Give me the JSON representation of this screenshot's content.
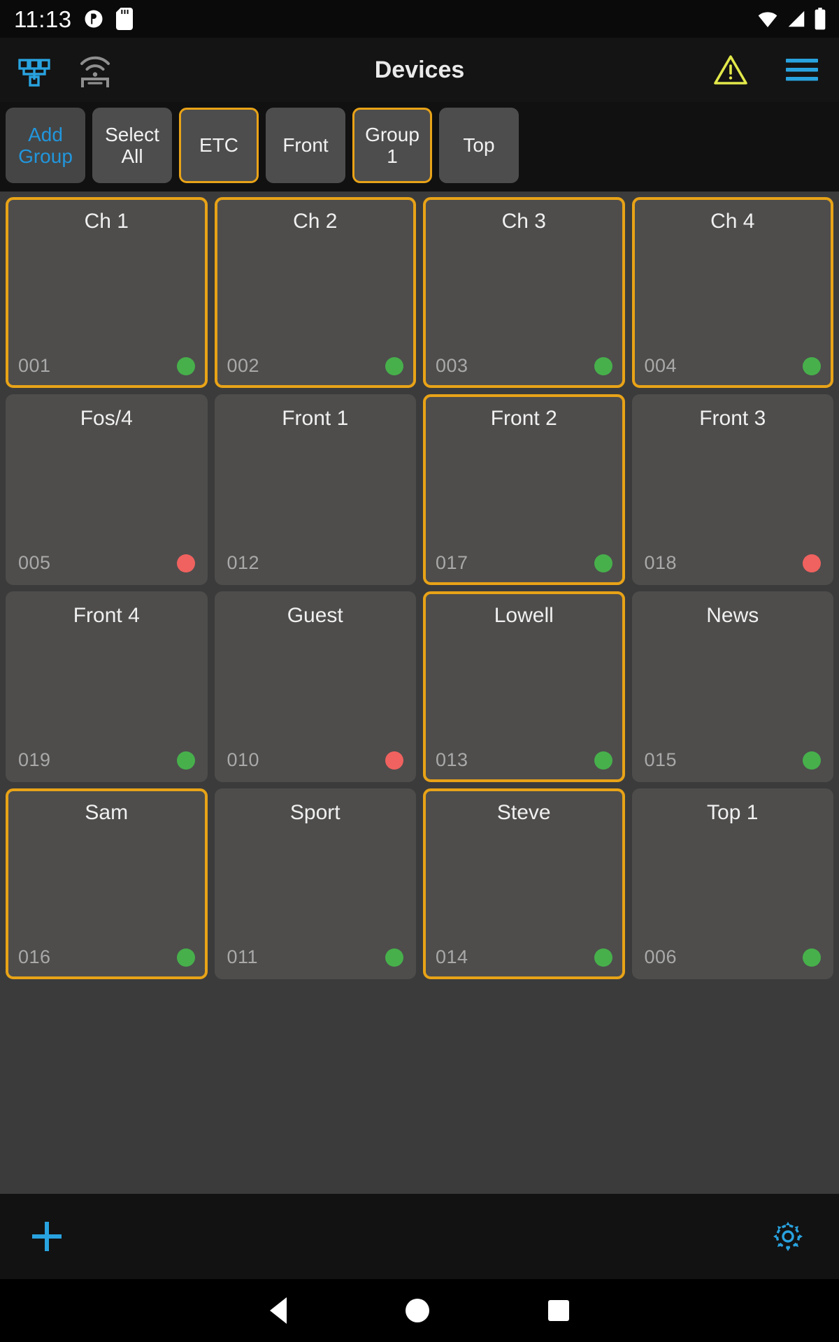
{
  "status_bar": {
    "clock": "11:13",
    "left_icons": [
      "do-not-disturb-icon",
      "sd-card-icon"
    ],
    "right_icons": [
      "wifi-icon",
      "cellular-signal-icon",
      "battery-icon"
    ]
  },
  "app_bar": {
    "title": "Devices",
    "left_icons": [
      "network-topology-icon",
      "wireless-access-point-icon"
    ],
    "right_icons": [
      "warning-icon",
      "menu-icon"
    ],
    "accent_blue": "#2196dd",
    "warning_color": "#e2e84a"
  },
  "group_bar": {
    "buttons": [
      {
        "label": "Add Group",
        "selected": false,
        "style": "add"
      },
      {
        "label": "Select All",
        "selected": false,
        "style": "normal"
      },
      {
        "label": "ETC",
        "selected": true,
        "style": "normal"
      },
      {
        "label": "Front",
        "selected": false,
        "style": "normal"
      },
      {
        "label": "Group 1",
        "selected": true,
        "style": "normal"
      },
      {
        "label": "Top",
        "selected": false,
        "style": "normal"
      }
    ],
    "selected_border_color": "#e8a317"
  },
  "devices": [
    {
      "name": "Ch 1",
      "id": "001",
      "status": "green",
      "selected": true
    },
    {
      "name": "Ch 2",
      "id": "002",
      "status": "green",
      "selected": true
    },
    {
      "name": "Ch 3",
      "id": "003",
      "status": "green",
      "selected": true
    },
    {
      "name": "Ch 4",
      "id": "004",
      "status": "green",
      "selected": true
    },
    {
      "name": "Fos/4",
      "id": "005",
      "status": "red",
      "selected": false
    },
    {
      "name": "Front 1",
      "id": "012",
      "status": "none",
      "selected": false
    },
    {
      "name": "Front 2",
      "id": "017",
      "status": "green",
      "selected": true
    },
    {
      "name": "Front 3",
      "id": "018",
      "status": "red",
      "selected": false
    },
    {
      "name": "Front 4",
      "id": "019",
      "status": "green",
      "selected": false
    },
    {
      "name": "Guest",
      "id": "010",
      "status": "red",
      "selected": false
    },
    {
      "name": "Lowell",
      "id": "013",
      "status": "green",
      "selected": true
    },
    {
      "name": "News",
      "id": "015",
      "status": "green",
      "selected": false
    },
    {
      "name": "Sam",
      "id": "016",
      "status": "green",
      "selected": true
    },
    {
      "name": "Sport",
      "id": "011",
      "status": "green",
      "selected": false
    },
    {
      "name": "Steve",
      "id": "014",
      "status": "green",
      "selected": true
    },
    {
      "name": "Top 1",
      "id": "006",
      "status": "green",
      "selected": false
    }
  ],
  "status_colors": {
    "green": "#47b04b",
    "red": "#f0625f"
  },
  "bottom_bar": {
    "left_icon": "add-plus-icon",
    "right_icon": "settings-gear-icon",
    "icon_color": "#2196dd"
  },
  "nav_bar": {
    "items": [
      "back-icon",
      "home-icon",
      "recents-icon"
    ]
  }
}
